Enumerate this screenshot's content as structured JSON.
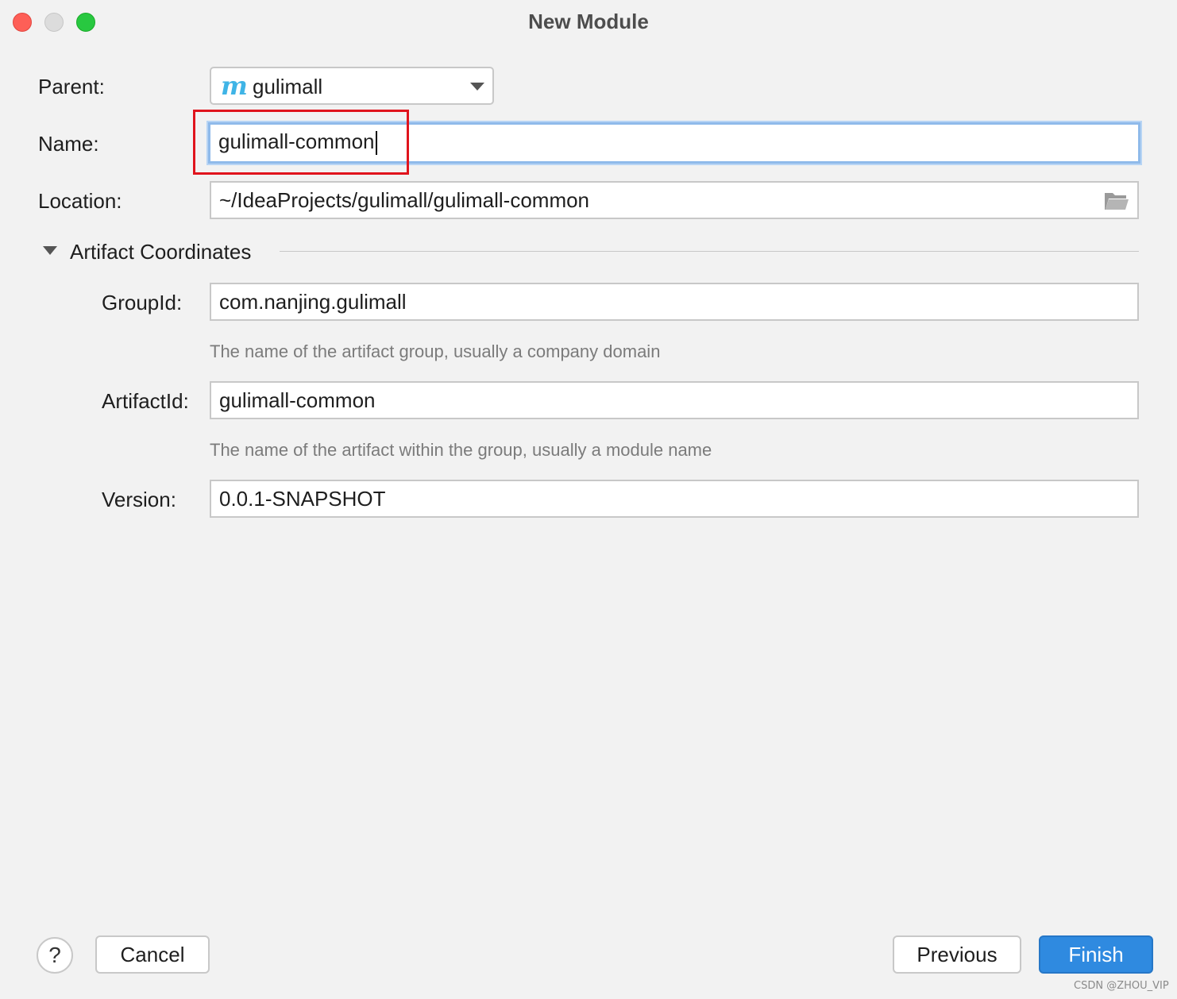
{
  "window": {
    "title": "New Module"
  },
  "form": {
    "parent_label": "Parent:",
    "parent_icon": "maven-module-icon",
    "parent_icon_glyph": "m",
    "parent_value": "gulimall",
    "name_label": "Name:",
    "name_value": "gulimall-common",
    "location_label": "Location:",
    "location_value": "~/IdeaProjects/gulimall/gulimall-common"
  },
  "artifact": {
    "section_title": "Artifact Coordinates",
    "group_label": "GroupId:",
    "group_value": "com.nanjing.gulimall",
    "group_hint": "The name of the artifact group, usually a company domain",
    "artifact_label": "ArtifactId:",
    "artifact_value": "gulimall-common",
    "artifact_hint": "The name of the artifact within the group, usually a module name",
    "version_label": "Version:",
    "version_value": "0.0.1-SNAPSHOT"
  },
  "buttons": {
    "help": "?",
    "cancel": "Cancel",
    "previous": "Previous",
    "finish": "Finish"
  },
  "colors": {
    "accent": "#2f8ae0",
    "highlight": "#e0141d",
    "maven_icon": "#3fb4e6"
  },
  "watermark": "CSDN @ZHOU_VIP"
}
